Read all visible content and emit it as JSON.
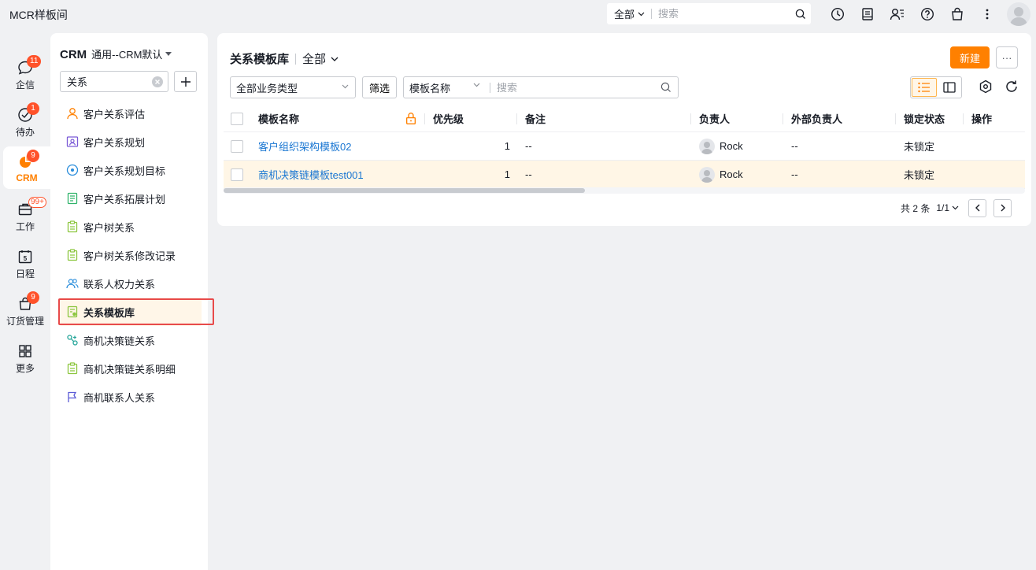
{
  "app": {
    "title": "MCR样板间"
  },
  "global_search": {
    "scope": "全部",
    "placeholder": "搜索"
  },
  "top_icons": [
    "clock-icon",
    "notebook-icon",
    "contacts-icon",
    "help-icon",
    "shopping-bag-icon",
    "more-vertical-icon"
  ],
  "rail": {
    "items": [
      {
        "label": "企信",
        "icon": "chat-icon",
        "badge": "11"
      },
      {
        "label": "待办",
        "icon": "check-circle-icon",
        "badge": "1"
      },
      {
        "label": "CRM",
        "icon": "crm-pie-icon",
        "badge": "9",
        "active": true
      },
      {
        "label": "工作",
        "icon": "briefcase-icon",
        "badge": "99+"
      },
      {
        "label": "日程",
        "icon": "calendar-icon",
        "badge": "",
        "day": "5"
      },
      {
        "label": "订货管理",
        "icon": "bag-icon",
        "badge": "9"
      },
      {
        "label": "更多",
        "icon": "grid-icon",
        "badge": ""
      }
    ]
  },
  "subnav": {
    "brand": "CRM",
    "scope": "通用--CRM默认",
    "search_value": "关系",
    "items": [
      {
        "label": "客户关系评估",
        "icon": "person-icon",
        "color": "#ff8000"
      },
      {
        "label": "客户关系规划",
        "icon": "profile-card-icon",
        "color": "#7b5bd6"
      },
      {
        "label": "客户关系规划目标",
        "icon": "target-icon",
        "color": "#2a8ddb"
      },
      {
        "label": "客户关系拓展计划",
        "icon": "document-icon",
        "color": "#30b36b"
      },
      {
        "label": "客户树关系",
        "icon": "clipboard-icon",
        "color": "#8cc63f"
      },
      {
        "label": "客户树关系修改记录",
        "icon": "clipboard-icon",
        "color": "#8cc63f"
      },
      {
        "label": "联系人权力关系",
        "icon": "people-icon",
        "color": "#2a8ddb"
      },
      {
        "label": "关系模板库",
        "icon": "template-doc-icon",
        "color": "#8cc63f",
        "active": true
      },
      {
        "label": "商机决策链关系",
        "icon": "link-chain-icon",
        "color": "#26a69a"
      },
      {
        "label": "商机决策链关系明细",
        "icon": "clipboard-icon",
        "color": "#8cc63f"
      },
      {
        "label": "商机联系人关系",
        "icon": "flag-icon",
        "color": "#5b5bd6"
      }
    ]
  },
  "main": {
    "title": "关系模板库",
    "scope": "全部",
    "new_label": "新建",
    "more_label": "···",
    "filters": {
      "business_type": "全部业务类型",
      "filter_label": "筛选",
      "search_field": "模板名称",
      "search_placeholder": "搜索"
    },
    "table": {
      "columns": [
        "模板名称",
        "优先级",
        "备注",
        "负责人",
        "外部负责人",
        "锁定状态",
        "操作"
      ],
      "rows": [
        {
          "name": "客户组织架构模板02",
          "priority": "1",
          "remark": "--",
          "owner": "Rock",
          "external_owner": "--",
          "lock_status": "未锁定"
        },
        {
          "name": "商机决策链模板test001",
          "priority": "1",
          "remark": "--",
          "owner": "Rock",
          "external_owner": "--",
          "lock_status": "未锁定",
          "selected": true
        }
      ]
    },
    "pager": {
      "total": "共 2 条",
      "pages": "1/1"
    }
  },
  "colors": {
    "accent": "#ff8000",
    "link": "#1976d2",
    "badge": "#ff522a",
    "highlight": "#e84a4a"
  }
}
